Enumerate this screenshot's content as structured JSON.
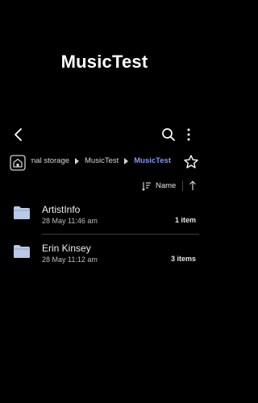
{
  "app": {
    "title": "MusicTest"
  },
  "toolbar": {
    "back_icon": "chevron-left-icon",
    "search_icon": "search-icon",
    "more_icon": "more-vertical-icon"
  },
  "breadcrumb": {
    "home_icon": "home-icon",
    "items": [
      {
        "label": "Internal storage"
      },
      {
        "label": "MusicTest"
      },
      {
        "label": "MusicTest",
        "active": true
      }
    ],
    "favorite_icon": "star-outline-icon",
    "active_color": "#7f97f5"
  },
  "sort": {
    "label": "Name",
    "icon": "sort-icon",
    "direction_icon": "arrow-up-icon"
  },
  "files": [
    {
      "name": "ArtistInfo",
      "date": "28 May 11:46 am",
      "count": "1 item"
    },
    {
      "name": "Erin Kinsey",
      "date": "28 May 11:12 am",
      "count": "3 items"
    }
  ],
  "colors": {
    "folder": "#b9c9e6",
    "background": "#000000"
  }
}
